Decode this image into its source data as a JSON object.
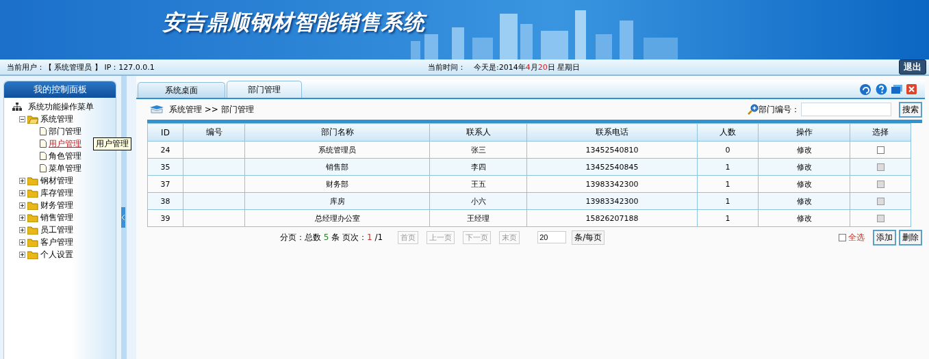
{
  "header": {
    "title": "安吉鼎顺钢材智能销售系统"
  },
  "status_bar": {
    "user": "当前用户：【 系统管理员 】 IP：127.0.0.1",
    "time_label": "当前时间：",
    "date_parts": [
      {
        "text": "今天是:2014年",
        "highlighted": false
      },
      {
        "text": "4",
        "highlighted": true
      },
      {
        "text": "月",
        "highlighted": false
      },
      {
        "text": "20",
        "highlighted": true
      },
      {
        "text": "日 星期日",
        "highlighted": false
      }
    ],
    "logout": "退出"
  },
  "sidebar": {
    "title": "我的控制面板",
    "tree": {
      "label": "系统功能操作菜单",
      "children": [
        {
          "label": "系统管理",
          "expanded": true,
          "children": [
            {
              "label": "部门管理",
              "hovered": false
            },
            {
              "label": "用户管理",
              "hovered": true
            },
            {
              "label": "角色管理",
              "hovered": false
            },
            {
              "label": "菜单管理",
              "hovered": false
            }
          ]
        },
        {
          "label": "钢材管理",
          "expanded": false
        },
        {
          "label": "库存管理",
          "expanded": false
        },
        {
          "label": "财务管理",
          "expanded": false
        },
        {
          "label": "销售管理",
          "expanded": false
        },
        {
          "label": "员工管理",
          "expanded": false
        },
        {
          "label": "客户管理",
          "expanded": false
        },
        {
          "label": "个人设置",
          "expanded": false
        }
      ]
    },
    "tooltip": "用户管理"
  },
  "tabs": [
    {
      "label": "系统桌面",
      "selected": false
    },
    {
      "label": "部门管理",
      "selected": true
    }
  ],
  "breadcrumb": "系统管理 >> 部门管理",
  "search": {
    "label": "部门编号：",
    "button": "搜索"
  },
  "table": {
    "columns": [
      "ID",
      "编号",
      "部门名称",
      "联系人",
      "联系电话",
      "人数",
      "操作",
      "选择"
    ],
    "rows": [
      {
        "id": "24",
        "name": "系统管理员",
        "contact": "张三",
        "phone": "13452540810",
        "count": "0",
        "action": "修改",
        "checked": false,
        "disabled": false
      },
      {
        "id": "35",
        "name": "销售部",
        "contact": "李四",
        "phone": "13452540845",
        "count": "1",
        "action": "修改",
        "checked": false,
        "disabled": true
      },
      {
        "id": "37",
        "name": "财务部",
        "contact": "王五",
        "phone": "13983342300",
        "count": "1",
        "action": "修改",
        "checked": false,
        "disabled": true
      },
      {
        "id": "38",
        "name": "库房",
        "contact": "小六",
        "phone": "13983342300",
        "count": "1",
        "action": "修改",
        "checked": false,
        "disabled": true
      },
      {
        "id": "39",
        "name": "总经理办公室",
        "contact": "王经理",
        "phone": "15826207188",
        "count": "1",
        "action": "修改",
        "checked": false,
        "disabled": true
      }
    ]
  },
  "pager": {
    "parts": [
      {
        "text": "分页：总数 ",
        "kind": "text"
      },
      {
        "text": "5",
        "kind": "total"
      },
      {
        "text": " 条  页次：",
        "kind": "text"
      },
      {
        "text": "1",
        "kind": "current"
      },
      {
        "text": " /1",
        "kind": "text"
      }
    ],
    "buttons": [
      "首页",
      "上一页",
      "下一页",
      "末页"
    ],
    "page_size": "20",
    "page_size_button": "条/每页",
    "select_all": {
      "label": "全选",
      "checked": false
    },
    "actions": [
      "添加",
      "删除"
    ]
  }
}
